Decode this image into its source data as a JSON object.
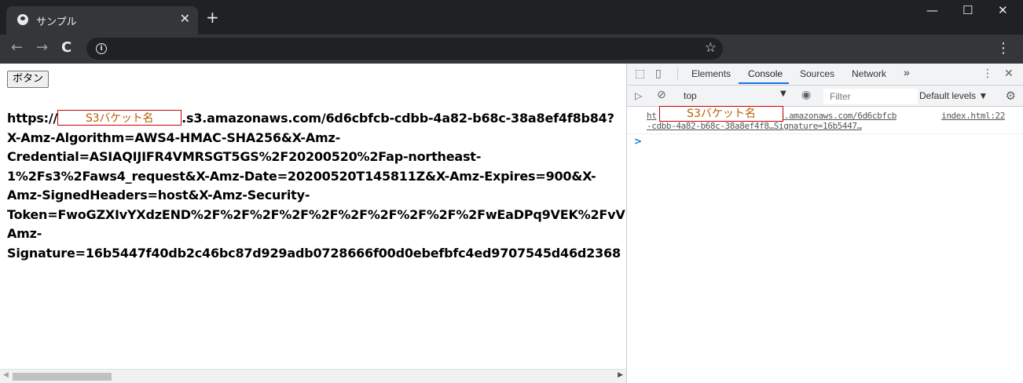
{
  "browser": {
    "tab_title": "サンプル",
    "tab_close": "✕",
    "new_tab": "+",
    "window_controls": {
      "minimize": "—",
      "maximize": "☐",
      "close": "✕"
    },
    "nav": {
      "back": "←",
      "forward": "→",
      "reload": "C"
    },
    "omnibox_info": "i",
    "bookmark_star": "☆",
    "menu": "⋮"
  },
  "page": {
    "button_label": "ボタン",
    "url_prefix": "https://",
    "redaction_label": "S3バケット名",
    "url_line1_rest": ".s3.amazonaws.com/6d6cbfcb-cdbb-4a82-b68c-38a8ef4f8b84?",
    "url_lines": [
      "X-Amz-Algorithm=AWS4-HMAC-SHA256&X-Amz-",
      "Credential=ASIAQIJIFR4VMRSGT5GS%2F20200520%2Fap-northeast-",
      "1%2Fs3%2Faws4_request&X-Amz-Date=20200520T145811Z&X-Amz-Expires=900&X-",
      "Amz-SignedHeaders=host&X-Amz-Security-",
      "Token=FwoGZXIvYXdzEND%2F%2F%2F%2F%2F%2F%2F%2F%2F%2FwEaDPq9VEK%2FvV",
      "Amz-",
      "Signature=16b5447f40db2c46bc87d929adb0728666f00d0ebefbfc4ed9707545d46d2368"
    ]
  },
  "devtools": {
    "tabs": [
      "Elements",
      "Console",
      "Sources",
      "Network",
      "»"
    ],
    "active_tab": "Console",
    "context": "top",
    "filter_placeholder": "Filter",
    "levels": "Default levels ▼",
    "log": {
      "line1_prefix": "ht",
      "line1_rest": "s3.amazonaws.com/6d6cbfcb",
      "line2": "-cdbb-4a82-b68c-38a8ef4f8…Signature=16b5447…",
      "source": "index.html:22",
      "redaction_label": "S3バケット名"
    },
    "prompt": ">"
  }
}
